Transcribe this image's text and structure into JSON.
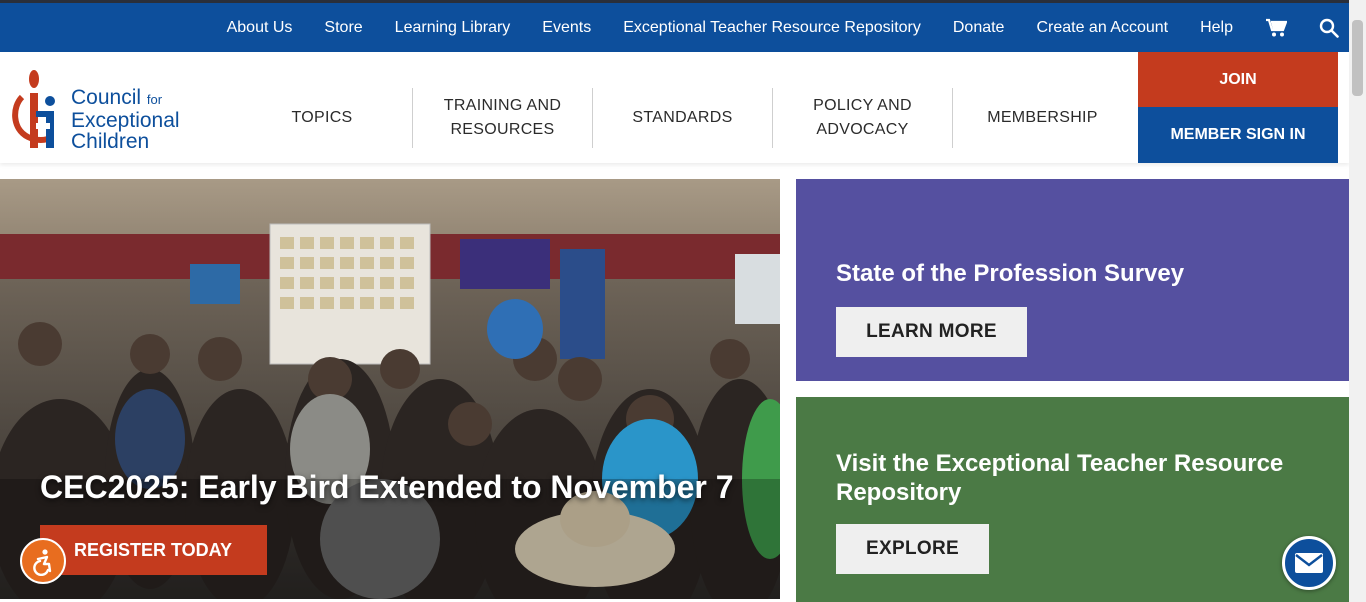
{
  "topnav": {
    "links": [
      "About Us",
      "Store",
      "Learning Library",
      "Events",
      "Exceptional Teacher Resource Repository",
      "Donate",
      "Create an Account",
      "Help"
    ],
    "cart_icon": "cart-icon",
    "search_icon": "search-icon"
  },
  "logo": {
    "line1": "Council",
    "for": "for",
    "line2": "Exceptional",
    "line3": "Children"
  },
  "mainnav": {
    "items": [
      {
        "line1": "TOPICS",
        "line2": ""
      },
      {
        "line1": "TRAINING AND",
        "line2": "RESOURCES"
      },
      {
        "line1": "STANDARDS",
        "line2": ""
      },
      {
        "line1": "POLICY AND",
        "line2": "ADVOCACY"
      },
      {
        "line1": "MEMBERSHIP",
        "line2": ""
      }
    ]
  },
  "account": {
    "join": "JOIN",
    "signin": "MEMBER SIGN IN"
  },
  "hero": {
    "title": "CEC2025: Early Bird Extended to November 7",
    "button": "REGISTER TODAY"
  },
  "cards": [
    {
      "title": "State of the Profession Survey",
      "button": "LEARN MORE"
    },
    {
      "title": "Visit the Exceptional Teacher Resource Repository",
      "button": "EXPLORE"
    }
  ],
  "colors": {
    "brand_blue": "#0d4f9c",
    "brand_red": "#c43b1e",
    "card_purple": "#5550a0",
    "card_green": "#4b7a45",
    "accessibility_orange": "#e86d1f"
  }
}
